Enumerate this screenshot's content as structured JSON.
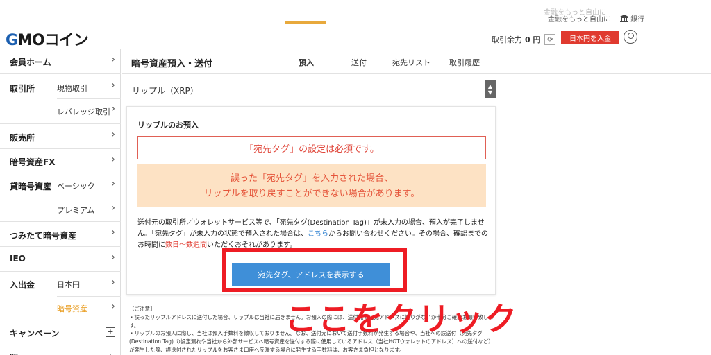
{
  "top_links": {
    "ghost_text": "金融をもっと自由に",
    "tagline": "金融をもっと自由に",
    "bank_label": "銀行"
  },
  "header": {
    "logo_prefix": "G",
    "logo_text": "MOコイン",
    "balance_label": "取引余力",
    "balance_value": "0 円",
    "deposit_button": "日本円を入金"
  },
  "sidebar": {
    "items": [
      {
        "main": "会員ホーム",
        "sub": ""
      },
      {
        "main": "取引所",
        "sub": "現物取引"
      },
      {
        "main": "",
        "sub": "レバレッジ取引"
      },
      {
        "main": "販売所",
        "sub": ""
      },
      {
        "main": "暗号資産FX",
        "sub": ""
      },
      {
        "main": "貸暗号資産",
        "sub": "ベーシック"
      },
      {
        "main": "",
        "sub": "プレミアム"
      },
      {
        "main": "つみたて暗号資産",
        "sub": ""
      },
      {
        "main": "IEO",
        "sub": ""
      },
      {
        "main": "入出金",
        "sub": "日本円"
      },
      {
        "main": "",
        "sub": "暗号資産"
      },
      {
        "main": "キャンペーン",
        "sub": ""
      },
      {
        "main": "照",
        "sub": ""
      }
    ]
  },
  "page": {
    "title": "暗号資産預入・送付",
    "tabs": [
      "預入",
      "送付",
      "宛先リスト",
      "取引履歴"
    ],
    "active_tab": "預入"
  },
  "asset_select": {
    "selected": "リップル（XRP）"
  },
  "card": {
    "title": "リップルのお預入",
    "warning": "「宛先タグ」の設定は必須です。",
    "caution_line1": "誤った「宛先タグ」を入力された場合、",
    "caution_line2": "リップルを取り戻すことができない場合があります。",
    "desc_part1": "送付元の取引所／ウォレットサービス等で、「宛先タグ(Destination Tag)」が未入力の場合、預入が完了しません。「宛先タグ」が未入力の状態で預入された場合は、",
    "desc_link": "こちら",
    "desc_part2": "からお問い合わせください。その場合、確認までのお時間に",
    "desc_red": "数日～数週間",
    "desc_part3": "いただくおそれがあります。",
    "show_button": "宛先タグ、アドレスを表示する"
  },
  "notes": {
    "heading": "【ご注意】",
    "line1": "・誤ったリップルアドレスに送付した場合、リップルは当社に届きません。お預入の際には、送付元で宛先アドレスに誤りがないか十分ご確認お願い致します。",
    "line2": "・リップルのお預入に際し、当社は預入手数料を徴収しておりません。なお、送付元において送付手数料が発生する場合や、当社への誤送付（宛先タグ(Destination Tag) の設定漏れや当社から外部サービスへ暗号資産を送付する際に使用しているアドレス（当社HOTウォレットのアドレス）への送付など）が発生した際、誤送付されたリップルをお客さま口座へ反映する場合に発生する手数料は、お客さま負担となります。"
  },
  "annotation": {
    "text": "ここをクリック"
  },
  "colors": {
    "accent_red": "#ee1c24",
    "button_blue": "#3f8fd8",
    "tab_orange": "#e8a93c",
    "caution_bg": "#fde2c4"
  }
}
